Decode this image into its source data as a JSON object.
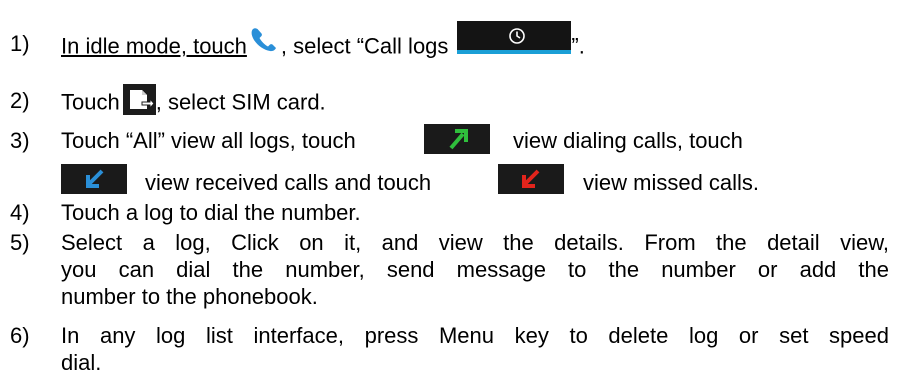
{
  "steps": [
    {
      "number": "1)",
      "parts": [
        "In idle mode, touch",
        ", select “Call logs",
        "”."
      ],
      "icons": [
        "phone-icon",
        "clock-icon"
      ]
    },
    {
      "number": "2)",
      "parts": [
        "Touch",
        ", select SIM card."
      ],
      "icons": [
        "sim-card-icon"
      ]
    },
    {
      "number": "3)",
      "parts": [
        "Touch “All” view all logs, touch",
        "view dialing calls, touch",
        "view received calls and touch",
        "view missed calls."
      ],
      "icons": [
        "outgoing-call-arrow-icon",
        "incoming-call-arrow-icon",
        "missed-call-arrow-icon"
      ]
    },
    {
      "number": "4)",
      "parts": [
        "Touch a log to dial the number."
      ]
    },
    {
      "number": "5)",
      "lines": [
        "Select a log, Click on it, and view the details. From the detail view,",
        "you can dial the number, send message to the number or add the",
        "number to the phonebook."
      ]
    },
    {
      "number": "6)",
      "lines": [
        "In any log list interface, press Menu key to delete log or set speed",
        "dial."
      ]
    }
  ],
  "colors": {
    "accent_blue": "#1a9fd6",
    "outgoing_green": "#2fbf3c",
    "incoming_blue": "#2a8fd8",
    "missed_red": "#e2241c"
  }
}
